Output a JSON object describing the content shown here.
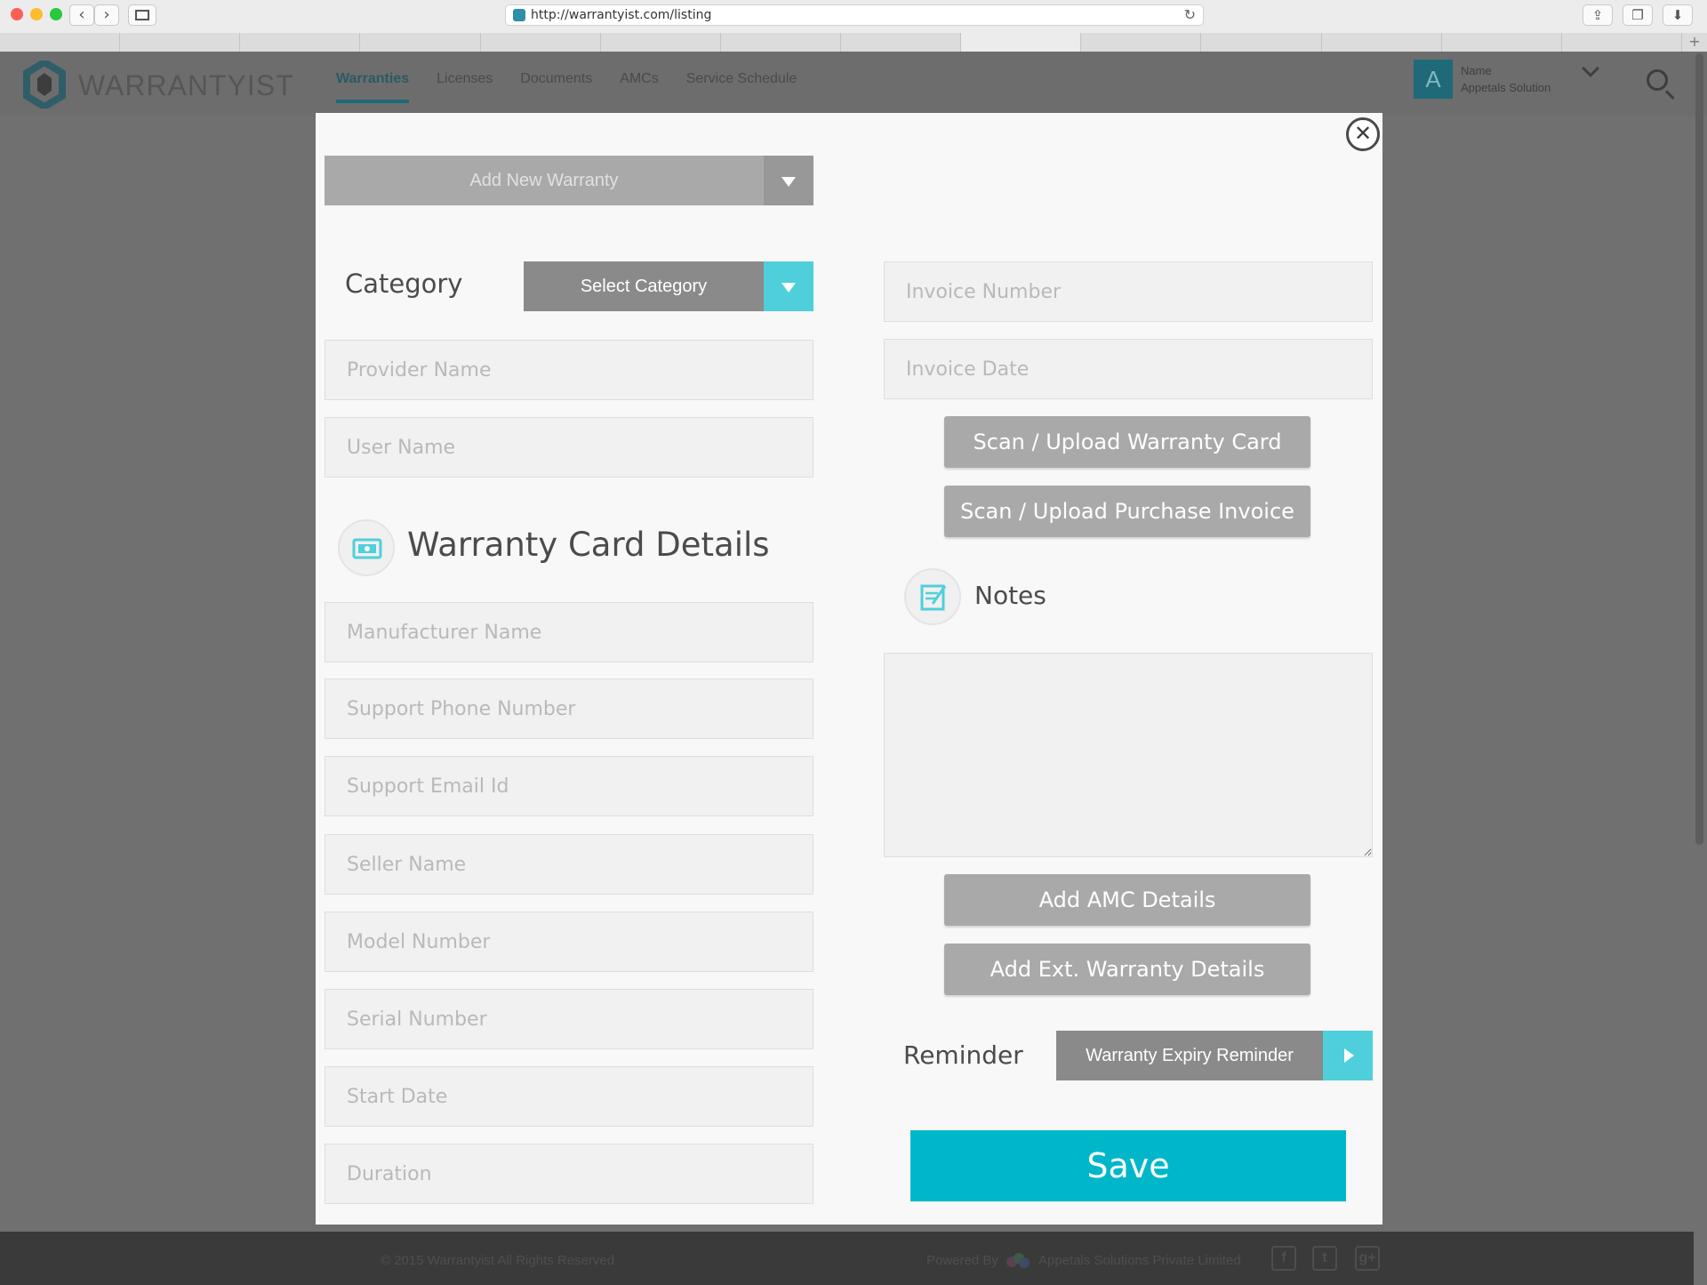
{
  "browser": {
    "url": "http://warrantyist.com/listing",
    "back_glyph": "‹",
    "forward_glyph": "›",
    "reload_glyph": "↻",
    "new_tab_glyph": "+"
  },
  "site": {
    "logo_text": "WARRANTYIST",
    "nav": [
      {
        "label": "Warranties",
        "active": true
      },
      {
        "label": "Licenses",
        "active": false
      },
      {
        "label": "Documents",
        "active": false
      },
      {
        "label": "AMCs",
        "active": false
      },
      {
        "label": "Service Schedule",
        "active": false
      }
    ],
    "user": {
      "initial": "A",
      "name_label": "Name",
      "company": "Appetals Solution"
    }
  },
  "footer": {
    "copyright": "© 2015 Warrantyist All Rights Reserved",
    "powered_by": "Powered By",
    "company": "Appetals Solutions Private Limited",
    "social": [
      "f",
      "t",
      "g+"
    ]
  },
  "modal": {
    "close_glyph": "✕",
    "add_new": "Add New Warranty",
    "category_label": "Category",
    "category_select": "Select Category",
    "left_fields_top": [
      {
        "placeholder": "Provider Name"
      },
      {
        "placeholder": "User Name"
      }
    ],
    "section_title": "Warranty Card Details",
    "left_fields": [
      {
        "placeholder": "Manufacturer Name"
      },
      {
        "placeholder": "Support Phone Number"
      },
      {
        "placeholder": "Support Email Id"
      },
      {
        "placeholder": "Seller Name"
      },
      {
        "placeholder": "Model Number"
      },
      {
        "placeholder": "Serial Number"
      },
      {
        "placeholder": "Start Date"
      },
      {
        "placeholder": "Duration"
      }
    ],
    "right_fields": [
      {
        "placeholder": "Invoice Number"
      },
      {
        "placeholder": "Invoice Date"
      }
    ],
    "scan_warranty": "Scan / Upload Warranty Card",
    "scan_invoice": "Scan / Upload Purchase Invoice",
    "notes_label": "Notes",
    "add_amc": "Add AMC Details",
    "add_ext": "Add Ext. Warranty Details",
    "reminder_label": "Reminder",
    "reminder_select": "Warranty Expiry Reminder",
    "save": "Save"
  },
  "colors": {
    "accent": "#00b7c9",
    "select_arrow": "#4fcfdb",
    "dropdown_grey": "#8a8a8a",
    "button_grey": "#a9a9a9",
    "overlay": "#707070"
  }
}
